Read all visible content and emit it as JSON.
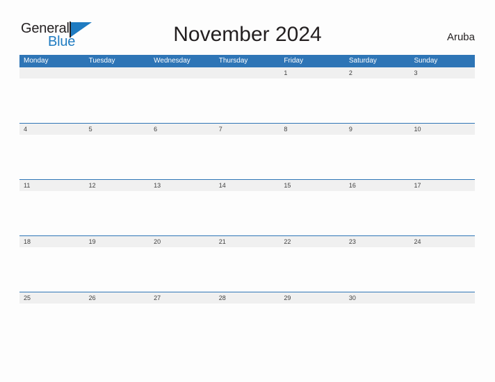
{
  "brand": {
    "name_part1": "General",
    "name_part2": "Blue",
    "flag_icon": "blue-triangle-flag-icon",
    "accent_color": "#1f7bc1"
  },
  "header": {
    "title": "November 2024",
    "locale": "Aruba"
  },
  "theme": {
    "header_blue": "#2e75b6",
    "date_band_gray": "#f0f0f0",
    "page_background": "#fdfdfd",
    "text_dark": "#231f20"
  },
  "calendar": {
    "weekdays": [
      "Monday",
      "Tuesday",
      "Wednesday",
      "Thursday",
      "Friday",
      "Saturday",
      "Sunday"
    ],
    "weeks": [
      {
        "days": [
          "",
          "",
          "",
          "",
          "1",
          "2",
          "3"
        ]
      },
      {
        "days": [
          "4",
          "5",
          "6",
          "7",
          "8",
          "9",
          "10"
        ]
      },
      {
        "days": [
          "11",
          "12",
          "13",
          "14",
          "15",
          "16",
          "17"
        ]
      },
      {
        "days": [
          "18",
          "19",
          "20",
          "21",
          "22",
          "23",
          "24"
        ]
      },
      {
        "days": [
          "25",
          "26",
          "27",
          "28",
          "29",
          "30",
          ""
        ]
      }
    ]
  }
}
